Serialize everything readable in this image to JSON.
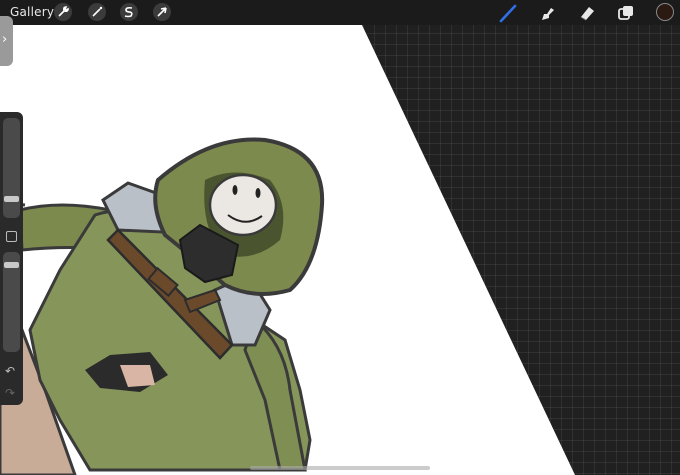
{
  "toolbar": {
    "gallery_label": "Gallery",
    "left_tools": [
      "wrench-icon",
      "magic-wand-icon",
      "selection-icon",
      "transform-icon"
    ],
    "right_tools": [
      "brush-icon",
      "smudge-icon",
      "eraser-icon",
      "layers-icon"
    ],
    "active_tool": "brush-icon",
    "accent_color": "#2f6fe8",
    "current_color": "#2a1a12"
  },
  "sidebar": {
    "brush_size_slider": "slider",
    "opacity_slider": "slider",
    "modify_button": "square-icon",
    "undo_icon": "undo-icon",
    "redo_icon": "redo-icon"
  },
  "canvas": {
    "background": "#ffffff",
    "workspace_background": "#202020"
  }
}
